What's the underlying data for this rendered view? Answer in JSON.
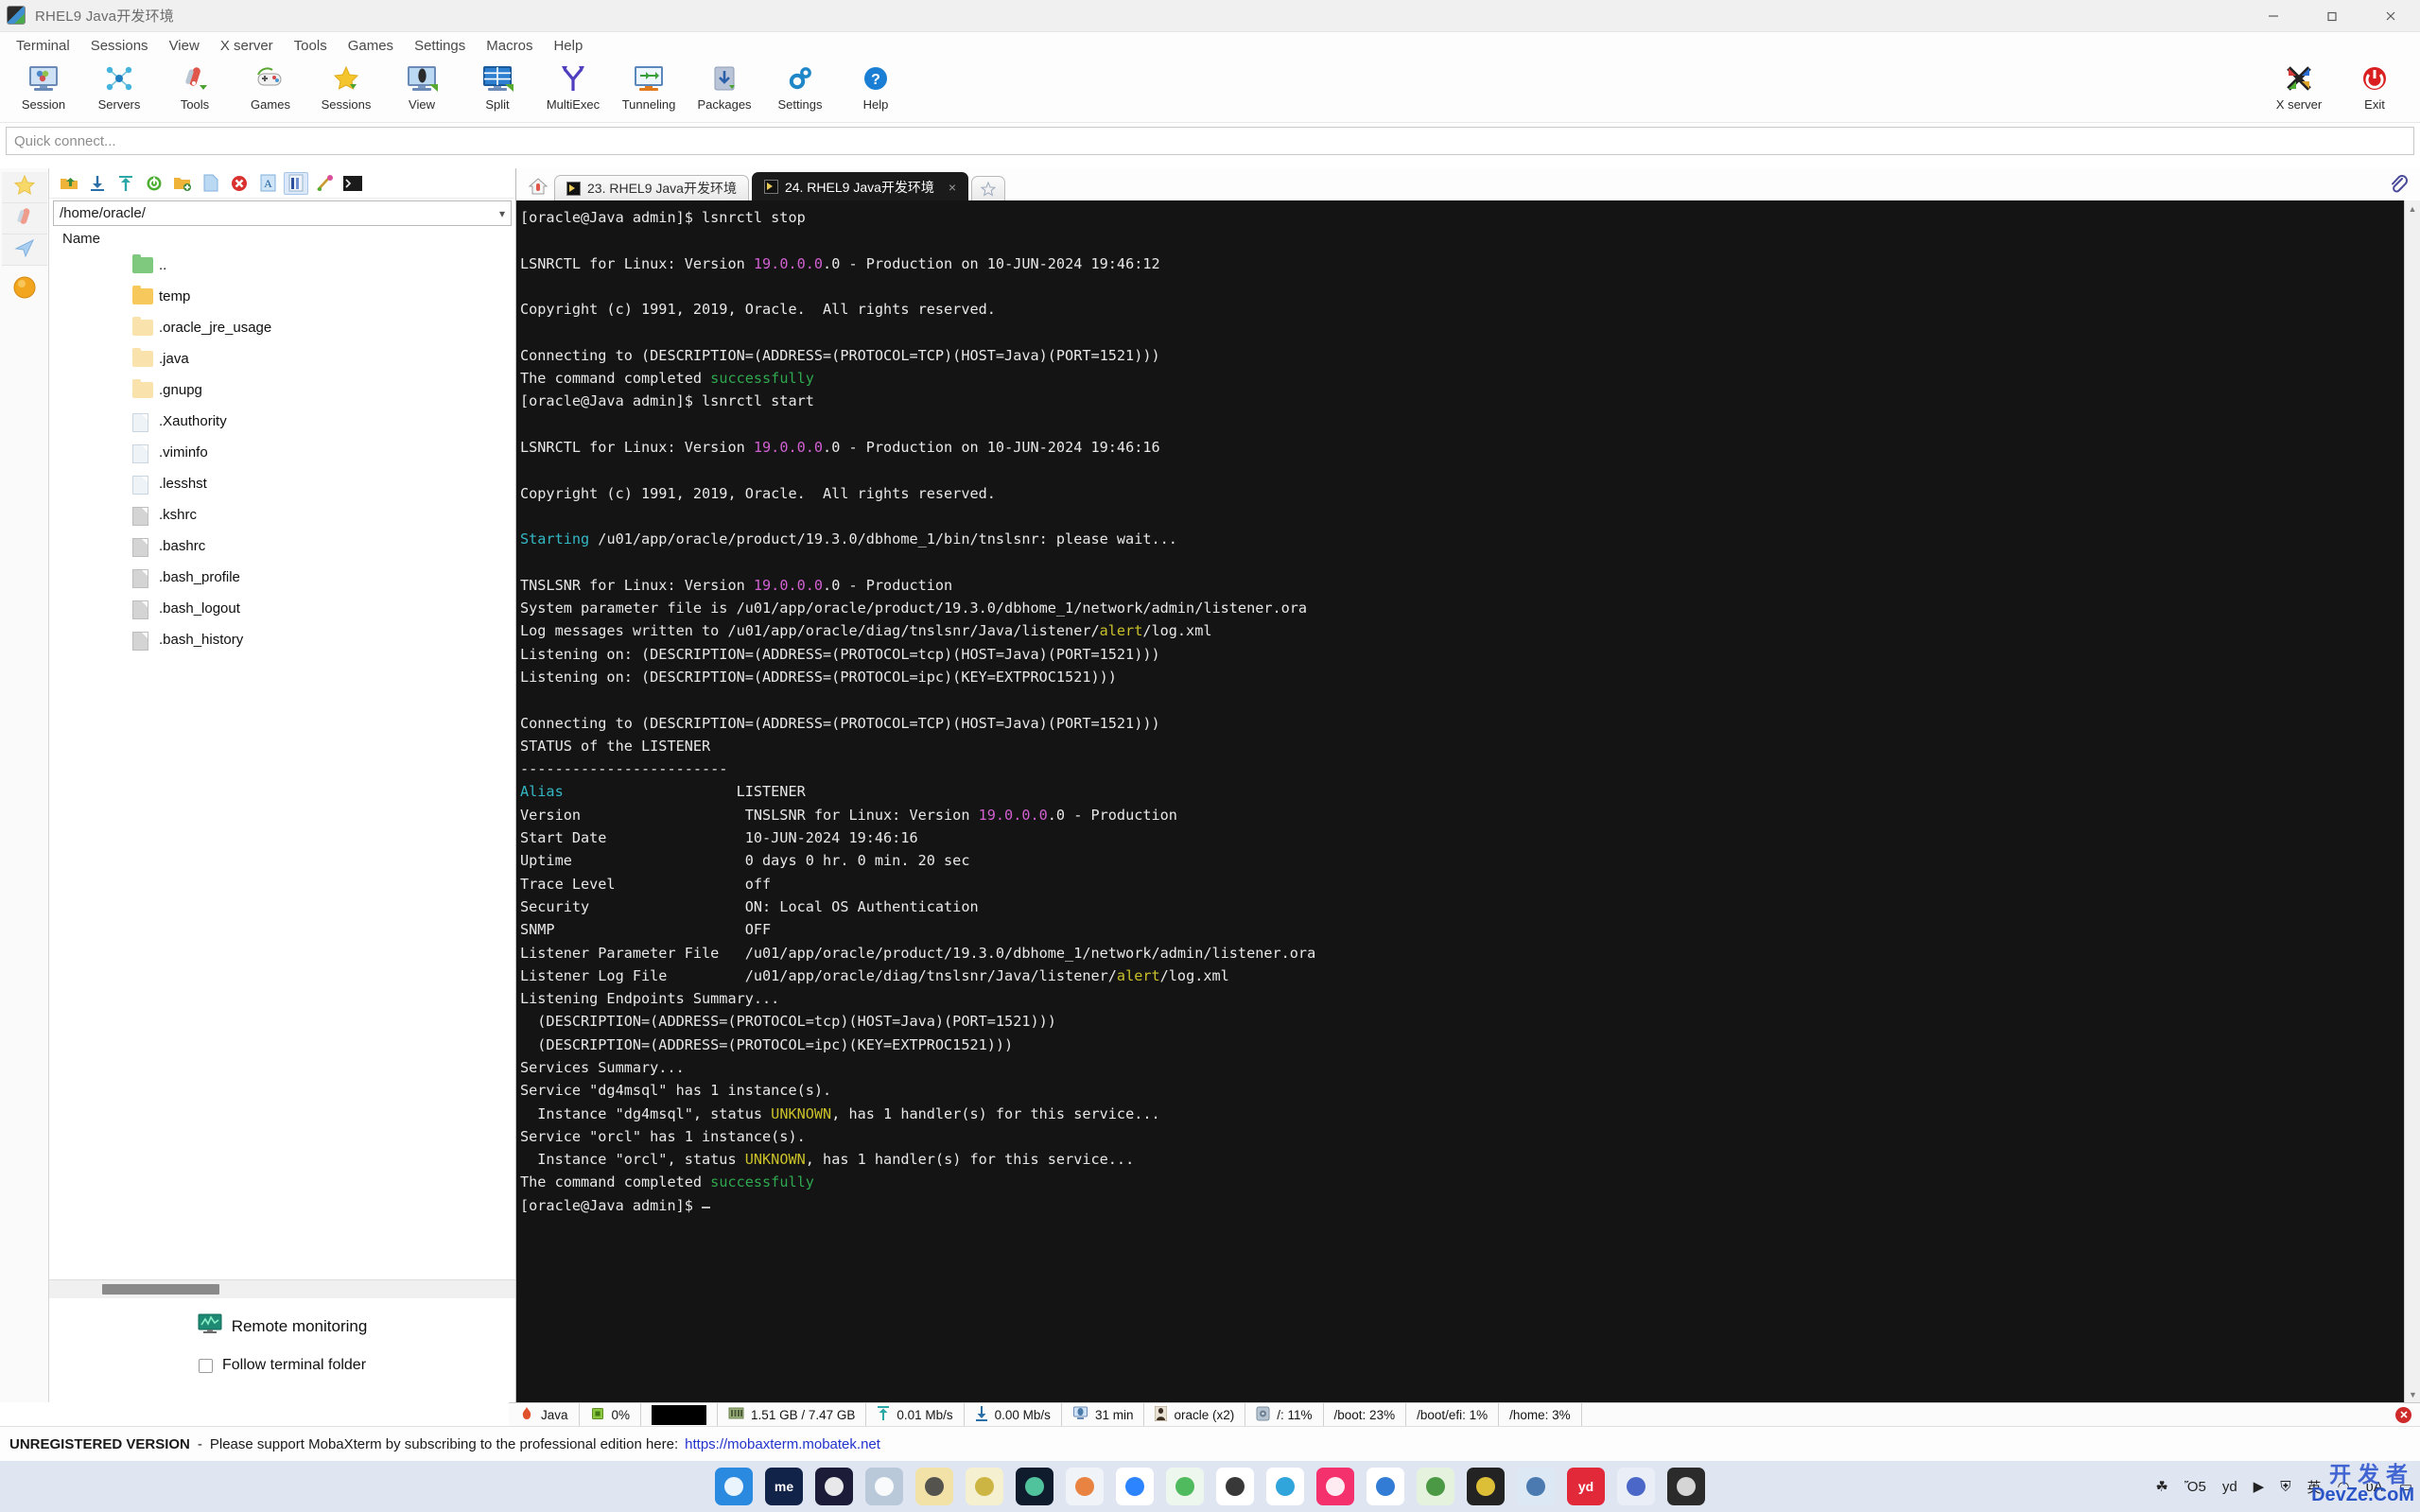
{
  "window": {
    "title": "RHEL9 Java开发环境",
    "app_icon": "mobaxterm-icon",
    "minimize": "minimize-icon",
    "maximize": "maximize-icon",
    "close": "close-icon"
  },
  "menubar": {
    "items": [
      "Terminal",
      "Sessions",
      "View",
      "X server",
      "Tools",
      "Games",
      "Settings",
      "Macros",
      "Help"
    ]
  },
  "toolbar": {
    "buttons": [
      {
        "label": "Session",
        "icon": "session-icon"
      },
      {
        "label": "Servers",
        "icon": "servers-icon"
      },
      {
        "label": "Tools",
        "icon": "tools-icon"
      },
      {
        "label": "Games",
        "icon": "games-icon"
      },
      {
        "label": "Sessions",
        "icon": "sessions-star-icon"
      },
      {
        "label": "View",
        "icon": "view-icon"
      },
      {
        "label": "Split",
        "icon": "split-icon"
      },
      {
        "label": "MultiExec",
        "icon": "multiexec-icon"
      },
      {
        "label": "Tunneling",
        "icon": "tunneling-icon"
      },
      {
        "label": "Packages",
        "icon": "packages-icon"
      },
      {
        "label": "Settings",
        "icon": "settings-gear-icon"
      },
      {
        "label": "Help",
        "icon": "help-icon"
      }
    ],
    "right_buttons": [
      {
        "label": "X server",
        "icon": "xserver-icon"
      },
      {
        "label": "Exit",
        "icon": "exit-power-icon"
      }
    ]
  },
  "quick_connect": {
    "placeholder": "Quick connect..."
  },
  "rail": {
    "items": [
      {
        "name": "sidebar-sessions-star",
        "icon": "star-icon"
      },
      {
        "name": "sidebar-tools",
        "icon": "swiss-knife-icon"
      },
      {
        "name": "sidebar-macros",
        "icon": "paper-plane-icon"
      },
      {
        "name": "sidebar-sftp",
        "icon": "orange-sphere-icon"
      }
    ]
  },
  "sftp": {
    "toolbar_icons": [
      "up-folder-icon",
      "download-icon",
      "upload-icon",
      "refresh-icon",
      "new-folder-icon",
      "new-file-icon",
      "delete-icon",
      "text-mode-icon",
      "details-icon",
      "permissions-icon",
      "terminal-icon"
    ],
    "path": "/home/oracle/",
    "path_chevron": "chevron-down-icon",
    "column_header": "Name",
    "files": [
      {
        "name": "..",
        "type": "parent"
      },
      {
        "name": "temp",
        "type": "folder"
      },
      {
        "name": ".oracle_jre_usage",
        "type": "folder-light"
      },
      {
        "name": ".java",
        "type": "folder-light"
      },
      {
        "name": ".gnupg",
        "type": "folder-light"
      },
      {
        "name": ".Xauthority",
        "type": "file"
      },
      {
        "name": ".viminfo",
        "type": "file"
      },
      {
        "name": ".lesshst",
        "type": "file"
      },
      {
        "name": ".kshrc",
        "type": "file-gray"
      },
      {
        "name": ".bashrc",
        "type": "file-gray"
      },
      {
        "name": ".bash_profile",
        "type": "file-gray"
      },
      {
        "name": ".bash_logout",
        "type": "file-gray"
      },
      {
        "name": ".bash_history",
        "type": "file-gray"
      }
    ],
    "remote_monitoring": "Remote monitoring",
    "remote_monitoring_icon": "monitor-graph-icon",
    "follow_terminal_folder": "Follow terminal folder",
    "follow_checked": false
  },
  "tabs": {
    "home_icon": "home-icon",
    "new_tab_icon": "new-tab-star-icon",
    "items": [
      {
        "label": "23. RHEL9 Java开发环境",
        "active": false,
        "icon": "terminal-tab-icon"
      },
      {
        "label": "24. RHEL9 Java开发环境",
        "active": true,
        "icon": "terminal-tab-icon",
        "close": "×"
      }
    ],
    "attach_icon": "paperclip-icon"
  },
  "terminal": {
    "colors": {
      "bg": "#141414",
      "fg": "#e8e8e8",
      "magenta": "#d060d0",
      "green": "#2fa84f",
      "cyan": "#34b7c4",
      "yellow": "#c9c02a"
    },
    "lines": [
      [
        {
          "t": "[oracle@Java admin]$ lsnrctl stop"
        }
      ],
      [],
      [
        {
          "t": "LSNRCTL for Linux: Version "
        },
        {
          "t": "19.0.0.0",
          "c": "c-mag"
        },
        {
          "t": ".0 - Production on 10-JUN-2024 19:46:12"
        }
      ],
      [],
      [
        {
          "t": "Copyright (c) 1991, 2019, Oracle.  All rights reserved."
        }
      ],
      [],
      [
        {
          "t": "Connecting to (DESCRIPTION=(ADDRESS=(PROTOCOL=TCP)(HOST=Java)(PORT=1521)))"
        }
      ],
      [
        {
          "t": "The command completed "
        },
        {
          "t": "successfully",
          "c": "c-grn"
        }
      ],
      [
        {
          "t": "[oracle@Java admin]$ lsnrctl start"
        }
      ],
      [],
      [
        {
          "t": "LSNRCTL for Linux: Version "
        },
        {
          "t": "19.0.0.0",
          "c": "c-mag"
        },
        {
          "t": ".0 - Production on 10-JUN-2024 19:46:16"
        }
      ],
      [],
      [
        {
          "t": "Copyright (c) 1991, 2019, Oracle.  All rights reserved."
        }
      ],
      [],
      [
        {
          "t": "Starting",
          "c": "c-cyan"
        },
        {
          "t": " /u01/app/oracle/product/19.3.0/dbhome_1/bin/tnslsnr: please wait..."
        }
      ],
      [],
      [
        {
          "t": "TNSLSNR for Linux: Version "
        },
        {
          "t": "19.0.0.0",
          "c": "c-mag"
        },
        {
          "t": ".0 - Production"
        }
      ],
      [
        {
          "t": "System parameter file is /u01/app/oracle/product/19.3.0/dbhome_1/network/admin/listener.ora"
        }
      ],
      [
        {
          "t": "Log messages written to /u01/app/oracle/diag/tnslsnr/Java/listener/"
        },
        {
          "t": "alert",
          "c": "c-yel"
        },
        {
          "t": "/log.xml"
        }
      ],
      [
        {
          "t": "Listening on: (DESCRIPTION=(ADDRESS=(PROTOCOL=tcp)(HOST=Java)(PORT=1521)))"
        }
      ],
      [
        {
          "t": "Listening on: (DESCRIPTION=(ADDRESS=(PROTOCOL=ipc)(KEY=EXTPROC1521)))"
        }
      ],
      [],
      [
        {
          "t": "Connecting to (DESCRIPTION=(ADDRESS=(PROTOCOL=TCP)(HOST=Java)(PORT=1521)))"
        }
      ],
      [
        {
          "t": "STATUS of the LISTENER"
        }
      ],
      [
        {
          "t": "------------------------"
        }
      ],
      [
        {
          "t": "Alias",
          "c": "c-cyan"
        },
        {
          "t": "                    LISTENER"
        }
      ],
      [
        {
          "t": "Version                   TNSLSNR for Linux: Version "
        },
        {
          "t": "19.0.0.0",
          "c": "c-mag"
        },
        {
          "t": ".0 - Production"
        }
      ],
      [
        {
          "t": "Start Date                10-JUN-2024 19:46:16"
        }
      ],
      [
        {
          "t": "Uptime                    0 days 0 hr. 0 min. 20 sec"
        }
      ],
      [
        {
          "t": "Trace Level               off"
        }
      ],
      [
        {
          "t": "Security                  ON: Local OS Authentication"
        }
      ],
      [
        {
          "t": "SNMP                      OFF"
        }
      ],
      [
        {
          "t": "Listener Parameter File   /u01/app/oracle/product/19.3.0/dbhome_1/network/admin/listener.ora"
        }
      ],
      [
        {
          "t": "Listener Log File         /u01/app/oracle/diag/tnslsnr/Java/listener/"
        },
        {
          "t": "alert",
          "c": "c-yel"
        },
        {
          "t": "/log.xml"
        }
      ],
      [
        {
          "t": "Listening Endpoints Summary..."
        }
      ],
      [
        {
          "t": "  (DESCRIPTION=(ADDRESS=(PROTOCOL=tcp)(HOST=Java)(PORT=1521)))"
        }
      ],
      [
        {
          "t": "  (DESCRIPTION=(ADDRESS=(PROTOCOL=ipc)(KEY=EXTPROC1521)))"
        }
      ],
      [
        {
          "t": "Services Summary..."
        }
      ],
      [
        {
          "t": "Service \"dg4msql\" has 1 instance(s)."
        }
      ],
      [
        {
          "t": "  Instance \"dg4msql\", status "
        },
        {
          "t": "UNKNOWN",
          "c": "c-yel"
        },
        {
          "t": ", has 1 handler(s) for this service..."
        }
      ],
      [
        {
          "t": "Service \"orcl\" has 1 instance(s)."
        }
      ],
      [
        {
          "t": "  Instance \"orcl\", status "
        },
        {
          "t": "UNKNOWN",
          "c": "c-yel"
        },
        {
          "t": ", has 1 handler(s) for this service..."
        }
      ],
      [
        {
          "t": "The command completed "
        },
        {
          "t": "successfully",
          "c": "c-grn"
        }
      ],
      [
        {
          "t": "[oracle@Java admin]$ "
        },
        {
          "cursor": true
        }
      ]
    ]
  },
  "statusbar": {
    "items": [
      {
        "label": "Java",
        "icon": "session-flame-icon"
      },
      {
        "label": "0%",
        "icon": "cpu-icon"
      },
      {
        "label": "",
        "icon": "black-box"
      },
      {
        "label": "1.51 GB / 7.47 GB",
        "icon": "ram-icon"
      },
      {
        "label": "0.01 Mb/s",
        "icon": "upload-arrow-icon"
      },
      {
        "label": "0.00 Mb/s",
        "icon": "download-arrow-icon"
      },
      {
        "label": "31 min",
        "icon": "uptime-icon"
      },
      {
        "label": "oracle (x2)",
        "icon": "users-icon"
      },
      {
        "label": "/: 11%",
        "icon": "disk-icon"
      },
      {
        "label": "/boot: 23%",
        "icon": ""
      },
      {
        "label": "/boot/efi: 1%",
        "icon": ""
      },
      {
        "label": "/home: 3%",
        "icon": ""
      }
    ],
    "close_icon": "close-status-icon"
  },
  "unregistered": {
    "bold": "UNREGISTERED VERSION",
    "dash": "-",
    "text": "Please support MobaXterm by subscribing to the professional edition here:",
    "link": "https://mobaxterm.mobatek.net"
  },
  "taskbar": {
    "apps": [
      {
        "name": "start-windows-icon",
        "glyph": "",
        "bg": "#2a8ae0",
        "fg": "#ffffff"
      },
      {
        "name": "me-app-icon",
        "glyph": "me",
        "bg": "#12234a",
        "fg": "#ffffff"
      },
      {
        "name": "dark-oval-icon",
        "glyph": "",
        "bg": "#1c1c38",
        "fg": "#ffffff"
      },
      {
        "name": "blue-doc-icon",
        "glyph": "",
        "bg": "#b9c9da",
        "fg": "#ffffff"
      },
      {
        "name": "xmind-icon",
        "glyph": "",
        "bg": "#f2e2a8",
        "fg": "#444"
      },
      {
        "name": "ring-yellow-icon",
        "glyph": "",
        "bg": "#f5f0cf",
        "fg": "#c8ae33"
      },
      {
        "name": "photoshop-icon",
        "glyph": "",
        "bg": "#0f1c2e",
        "fg": "#59d6a8"
      },
      {
        "name": "office-icon",
        "glyph": "",
        "bg": "#f0f4f8",
        "fg": "#e8772e"
      },
      {
        "name": "dingtalk-icon",
        "glyph": "",
        "bg": "#ffffff",
        "fg": "#1677ff"
      },
      {
        "name": "wechat-icon",
        "glyph": "",
        "bg": "#eef7ee",
        "fg": "#3eb34f"
      },
      {
        "name": "qq-penguin-icon",
        "glyph": "",
        "bg": "#ffffff",
        "fg": "#222"
      },
      {
        "name": "edge-icon",
        "glyph": "",
        "bg": "#ffffff",
        "fg": "#1a9bd7"
      },
      {
        "name": "red-app-icon",
        "glyph": "",
        "bg": "#f4316d",
        "fg": "#ffffff"
      },
      {
        "name": "blue-rings-icon",
        "glyph": "",
        "bg": "#ffffff",
        "fg": "#1c6ed0"
      },
      {
        "name": "green-tool-icon",
        "glyph": "",
        "bg": "#e5f2de",
        "fg": "#3b8f34"
      },
      {
        "name": "dark-yellow-icon",
        "glyph": "",
        "bg": "#232323",
        "fg": "#f2cf3a"
      },
      {
        "name": "calc-grid-icon",
        "glyph": "",
        "bg": "#dce9f5",
        "fg": "#3a6ea8"
      },
      {
        "name": "yd-dict-icon",
        "glyph": "yd",
        "bg": "#e2293a",
        "fg": "#ffffff"
      },
      {
        "name": "blue-paper-icon",
        "glyph": "",
        "bg": "#eaeef7",
        "fg": "#3a58c2"
      },
      {
        "name": "terminal-black-icon",
        "glyph": "",
        "bg": "#2b2b2b",
        "fg": "#e8e8e8"
      }
    ],
    "tray": [
      {
        "name": "green-leaf-tray-icon",
        "glyph": "☘"
      },
      {
        "name": "calendar-tray-icon",
        "glyph": "Ὄ5"
      },
      {
        "name": "yd-tray-icon",
        "glyph": "yd"
      },
      {
        "name": "play-tray-icon",
        "glyph": "▶"
      },
      {
        "name": "shield-tray-icon",
        "glyph": "⛨"
      },
      {
        "name": "ime-tray-label",
        "glyph": "英"
      },
      {
        "name": "wifi-tray-icon",
        "glyph": "◠"
      },
      {
        "name": "volume-tray-icon",
        "glyph": "ὐA"
      },
      {
        "name": "battery-tray-icon",
        "glyph": "▭"
      }
    ],
    "watermark_cn": "开发者",
    "watermark_en": "DevZe.CoM"
  }
}
